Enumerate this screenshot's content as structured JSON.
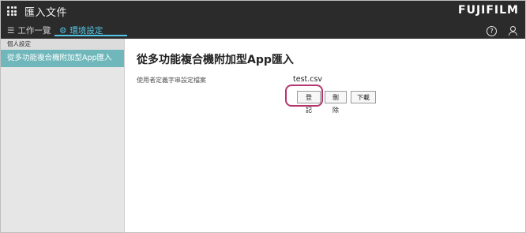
{
  "header": {
    "app_title": "匯入文件",
    "brand": "FUJIFILM",
    "tabs": [
      {
        "label": "工作一覽",
        "icon": "list-icon",
        "active": false
      },
      {
        "label": "環境設定",
        "icon": "gear-icon",
        "active": true
      }
    ],
    "help_icon_glyph": "?"
  },
  "sidebar": {
    "section_label": "個人設定",
    "items": [
      {
        "label": "從多功能複合機附加型App匯入",
        "selected": true
      }
    ]
  },
  "main": {
    "title": "從多功能複合機附加型App匯入",
    "field_label": "使用者定義字串設定檔案",
    "field_value": "test.csv",
    "buttons": {
      "register": "登記",
      "delete": "刪除",
      "download": "下載"
    }
  },
  "colors": {
    "topbar": "#2b2b2b",
    "accent": "#54c7e6",
    "sidebar_selected": "#6fb7bb",
    "highlight": "#b5366c"
  }
}
